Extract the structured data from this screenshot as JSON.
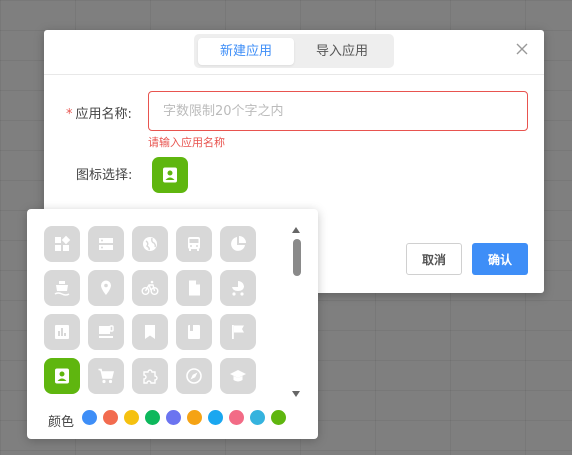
{
  "tabs": [
    {
      "label": "新建应用",
      "active": true
    },
    {
      "label": "导入应用",
      "active": false
    }
  ],
  "form": {
    "required_mark": "*",
    "name_label": "应用名称:",
    "name_value": "",
    "name_placeholder": "字数限制20个字之内",
    "name_error": "请输入应用名称",
    "icon_label": "图标选择:"
  },
  "buttons": {
    "cancel": "取消",
    "confirm": "确认"
  },
  "picker": {
    "icons": [
      "widgets-icon",
      "storage-icon",
      "globe-icon",
      "bus-icon",
      "pie-chart-icon",
      "ferry-icon",
      "location-pin-icon",
      "bicycle-icon",
      "document-icon",
      "stroller-icon",
      "bar-chart-icon",
      "coffee-icon",
      "bookmark-icon",
      "book-icon",
      "flag-icon",
      "contact-card-icon",
      "cart-icon",
      "puzzle-icon",
      "compass-icon",
      "graduation-cap-icon"
    ],
    "selected_icon": "contact-card-icon",
    "color_label": "颜色",
    "colors": [
      "#3e8ef7",
      "#f26b4f",
      "#f5c110",
      "#0db85c",
      "#6b74f0",
      "#f5a314",
      "#1aa7f0",
      "#f26b86",
      "#35b3de",
      "#5fb60f"
    ],
    "selected_color": "#5fb60f"
  }
}
